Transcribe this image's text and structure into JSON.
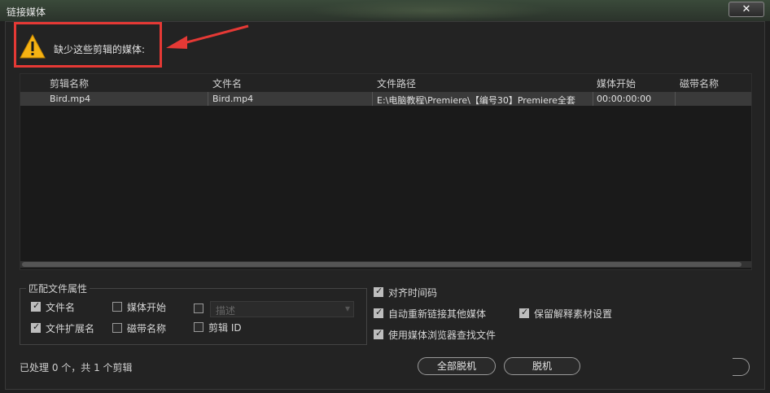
{
  "window": {
    "title": "链接媒体",
    "close_glyph": "✕"
  },
  "warning": {
    "message": "缺少这些剪辑的媒体:",
    "icon": "warning-icon",
    "highlight_color": "#e53935"
  },
  "table": {
    "columns": [
      "剪辑名称",
      "文件名",
      "文件路径",
      "媒体开始",
      "磁带名称"
    ],
    "rows": [
      {
        "clip_name": "Bird.mp4",
        "file_name": "Bird.mp4",
        "file_path": "E:\\电脑教程\\Premiere\\【编号30】Premiere全套",
        "media_start": "00:00:00:00",
        "tape_name": ""
      }
    ]
  },
  "match_group": {
    "label": "匹配文件属性",
    "options": [
      {
        "label": "文件名",
        "checked": true
      },
      {
        "label": "媒体开始",
        "checked": false
      },
      {
        "label": "文件扩展名",
        "checked": true
      },
      {
        "label": "磁带名称",
        "checked": false
      },
      {
        "label": "剪辑 ID",
        "checked": false
      }
    ],
    "description_checked": false,
    "description_placeholder": "描述"
  },
  "right_options": [
    {
      "label": "对齐时间码",
      "checked": true
    },
    {
      "label": "自动重新链接其他媒体",
      "checked": true
    },
    {
      "label": "保留解释素材设置",
      "checked": true
    },
    {
      "label": "使用媒体浏览器查找文件",
      "checked": true
    }
  ],
  "status": "已处理 0 个，共 1 个剪辑",
  "buttons": {
    "offline_all": "全部脱机",
    "offline": "脱机"
  }
}
